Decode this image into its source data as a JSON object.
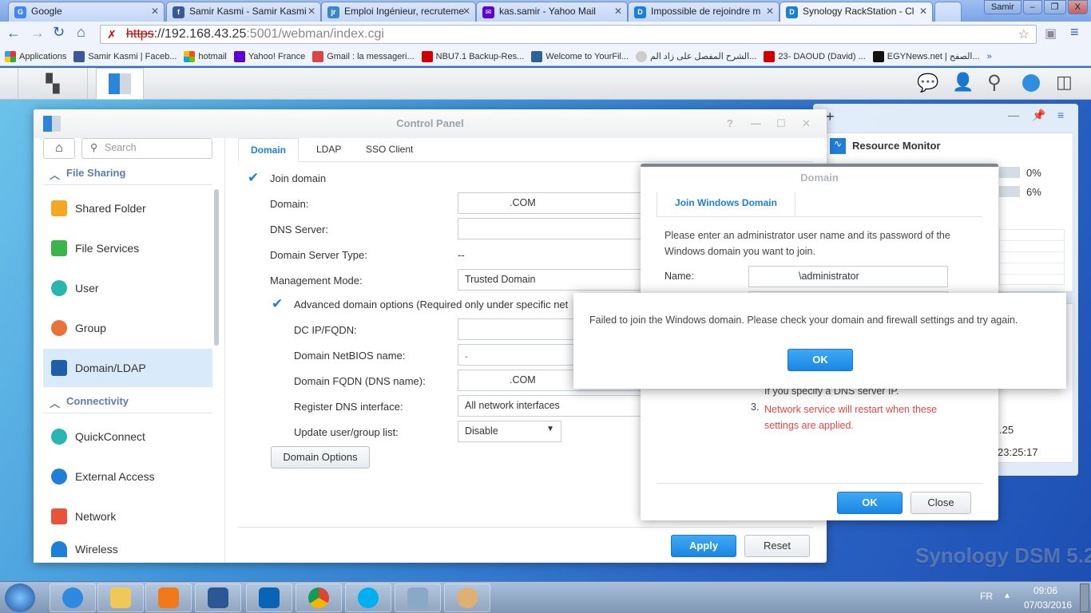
{
  "browser": {
    "tabs": [
      {
        "label": "Google",
        "icon": "google-icon"
      },
      {
        "label": "Samir Kasmi - Samir Kasmi",
        "icon": "facebook-icon"
      },
      {
        "label": "Emploi Ingénieur, recruteme",
        "icon": "jr-icon"
      },
      {
        "label": "kas.samir - Yahoo Mail",
        "icon": "yahoo-mail-icon"
      },
      {
        "label": "Impossible de rejoindre m",
        "icon": "dsm-icon"
      },
      {
        "label": "Synology RackStation - Cl",
        "icon": "dsm-icon"
      }
    ],
    "user": "Samir",
    "url_scheme": "https",
    "url_host": "://192.168.43.25",
    "url_rest": ":5001/webman/index.cgi",
    "bookmarks": [
      "Applications",
      "Samir Kasmi | Faceb...",
      "hotmail",
      "Yahoo! France",
      "Gmail : la messageri...",
      "NBU7.1 Backup-Res...",
      "Welcome to YourFil...",
      "الشرح المفصل على زاد الم...",
      "23- DAOUD (David) ...",
      "EGYNews.net | الصفح..."
    ],
    "more": "»"
  },
  "control_panel": {
    "title": "Control Panel",
    "search_placeholder": "Search",
    "sections": [
      "File Sharing",
      "Connectivity"
    ],
    "sidebar": [
      "Shared Folder",
      "File Services",
      "User",
      "Group",
      "Domain/LDAP",
      "QuickConnect",
      "External Access",
      "Network",
      "Wireless"
    ],
    "tabs": [
      "Domain",
      "LDAP",
      "SSO Client"
    ],
    "join_domain": "Join domain",
    "fields": {
      "domain_label": "Domain:",
      "domain_value": ".COM",
      "dns_label": "DNS Server:",
      "dns_value": "",
      "type_label": "Domain Server Type:",
      "type_value": "--",
      "mode_label": "Management Mode:",
      "mode_value": "Trusted Domain",
      "advanced": "Advanced domain options (Required only under specific net",
      "dc_label": "DC IP/FQDN:",
      "netbios_label": "Domain NetBIOS name:",
      "netbios_value": ".",
      "fqdn_label": "Domain FQDN (DNS name):",
      "fqdn_value": ".COM",
      "register_label": "Register DNS interface:",
      "register_value": "All network interfaces",
      "update_label": "Update user/group list:",
      "update_value": "Disable"
    },
    "domain_options": "Domain Options",
    "apply": "Apply",
    "reset": "Reset"
  },
  "resource_monitor": {
    "title": "Resource Monitor",
    "cpu": "0%",
    "ram": "6%",
    "cpu_value": 0,
    "ram_value": 6,
    "info1": ".25",
    "info2": "23:25:17"
  },
  "domain_dialog": {
    "title": "Domain",
    "tab": "Join Windows Domain",
    "instructions": "Please enter an administrator user name and its password of the Windows domain you want to join.",
    "name_label": "Name:",
    "name_value": "\\administrator",
    "note2_partial": "If you specify a DNS server IP.",
    "note3_num": "3.",
    "note3": "Network service will restart when these settings are applied.",
    "ok": "OK",
    "close": "Close"
  },
  "error_dialog": {
    "message": "Failed to join the Windows domain. Please check your domain and firewall settings and try again.",
    "ok": "OK"
  },
  "watermark": "Synology DSM 5.2",
  "taskbar": {
    "lang": "FR",
    "time": "09:06",
    "date": "07/03/2016"
  }
}
